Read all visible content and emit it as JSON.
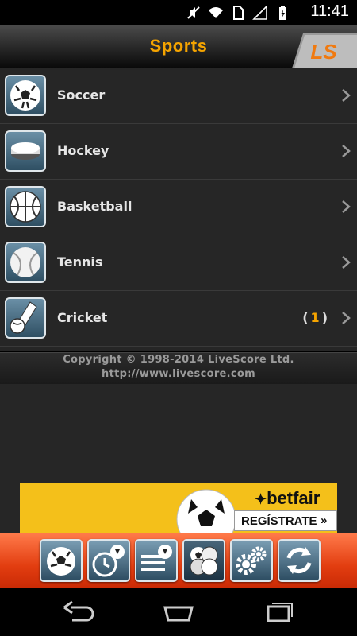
{
  "status_bar": {
    "time": "11:41",
    "icons": [
      "mute-icon",
      "wifi-icon",
      "sim-icon",
      "signal-icon",
      "battery-icon"
    ]
  },
  "header": {
    "title": "Sports",
    "logo_text": "LS"
  },
  "sports": [
    {
      "label": "Soccer",
      "icon": "soccer-ball-icon",
      "count": null
    },
    {
      "label": "Hockey",
      "icon": "hockey-puck-icon",
      "count": null
    },
    {
      "label": "Basketball",
      "icon": "basketball-icon",
      "count": null
    },
    {
      "label": "Tennis",
      "icon": "tennis-ball-icon",
      "count": null
    },
    {
      "label": "Cricket",
      "icon": "cricket-icon",
      "count": "1"
    }
  ],
  "count_open": "(",
  "count_close": ")",
  "footer": {
    "copyright": "Copyright © 1998-2014 LiveScore Ltd.",
    "url": "http://www.livescore.com"
  },
  "ad": {
    "brand": "betfair",
    "cta": "REGÍSTRATE",
    "cta_arrows": "»"
  },
  "toolbar": [
    {
      "name": "sports-tab",
      "icon": "soccer-ball-icon"
    },
    {
      "name": "live-scores-tab",
      "icon": "clock-icon"
    },
    {
      "name": "competitions-tab",
      "icon": "list-icon"
    },
    {
      "name": "all-sports-tab",
      "icon": "multi-ball-icon"
    },
    {
      "name": "settings-tab",
      "icon": "gears-icon"
    },
    {
      "name": "refresh-tab",
      "icon": "refresh-icon"
    }
  ],
  "colors": {
    "accent": "#f5a400",
    "toolbar": "#e23d10",
    "list_bg": "#262626",
    "ad_bg": "#f4c01a"
  }
}
